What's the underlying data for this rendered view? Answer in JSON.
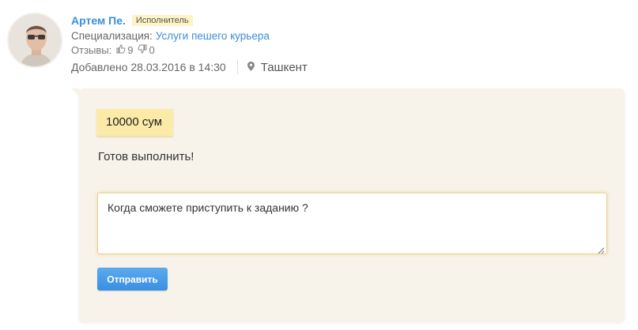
{
  "user": {
    "name": "Артем Пе.",
    "role": "Исполнитель",
    "spec_label": "Специализация:",
    "spec_value": "Услуги пешего курьера",
    "reviews_label": "Отзывы:",
    "likes": "9",
    "dislikes": "0",
    "added": "Добавлено 28.03.2016 в 14:30",
    "city": "Ташкент"
  },
  "offer": {
    "price": "10000 сум",
    "message": "Готов выполнить!"
  },
  "reply": {
    "value": "Когда сможете приступить к заданию ?",
    "button": "Отправить"
  },
  "colors": {
    "link": "#3a8fd6",
    "card": "#f7f3ea",
    "price_tag": "#fbeaa8",
    "button": "#3a8fe0"
  }
}
